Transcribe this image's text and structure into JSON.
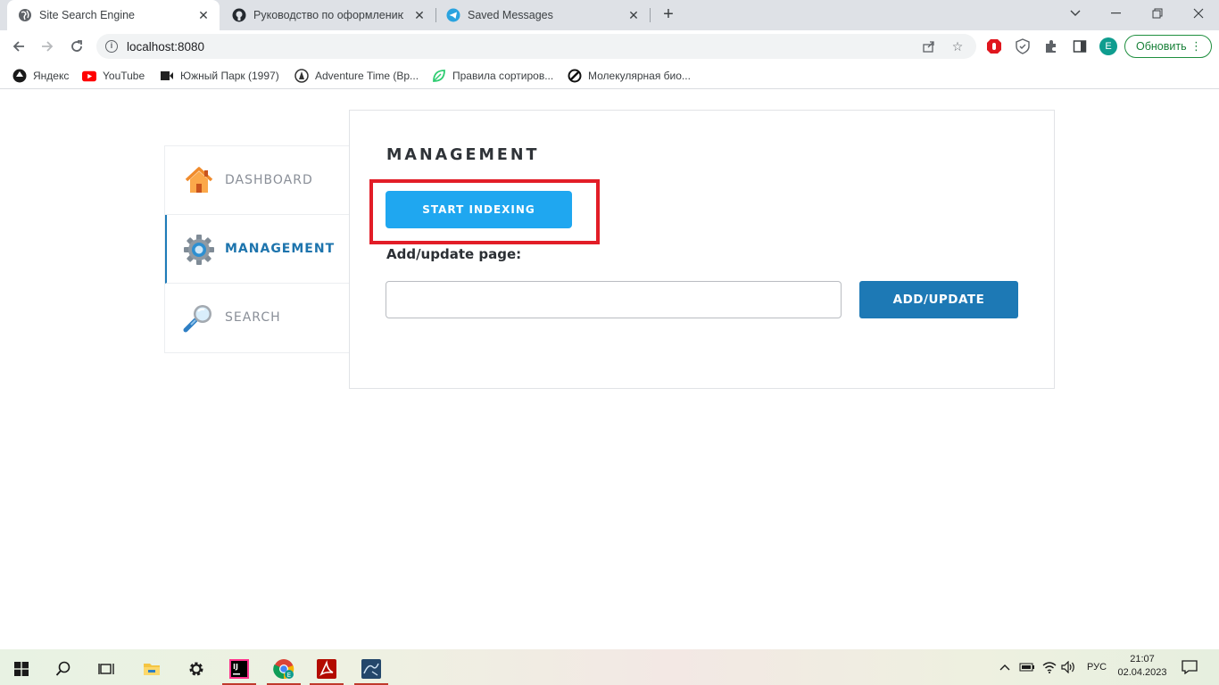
{
  "browser": {
    "tabs": [
      {
        "title": "Site Search Engine",
        "icon": "globe-icon",
        "active": true
      },
      {
        "title": "Руководство по оформлению M",
        "icon": "github-icon",
        "active": false
      },
      {
        "title": "Saved Messages",
        "icon": "telegram-icon",
        "active": false
      }
    ],
    "new_tab": "+",
    "url": "localhost:8080",
    "update_label": "Обновить",
    "profile_initial": "E"
  },
  "bookmarks": [
    {
      "label": "Яндекс",
      "icon": "yandex-icon"
    },
    {
      "label": "YouTube",
      "icon": "youtube-icon"
    },
    {
      "label": "Южный Парк (1997)",
      "icon": "video-icon"
    },
    {
      "label": "Adventure Time (Вр...",
      "icon": "adventure-time-icon"
    },
    {
      "label": "Правила сортиров...",
      "icon": "leaf-icon"
    },
    {
      "label": "Молекулярная био...",
      "icon": "link-icon"
    }
  ],
  "sidebar": {
    "items": [
      {
        "label": "DASHBOARD",
        "icon": "house-icon",
        "active": false
      },
      {
        "label": "MANAGEMENT",
        "icon": "gear-icon",
        "active": true
      },
      {
        "label": "SEARCH",
        "icon": "magnifier-icon",
        "active": false
      }
    ]
  },
  "main": {
    "heading": "MANAGEMENT",
    "start_button": "START INDEXING",
    "field_label": "Add/update page:",
    "page_input_value": "",
    "page_input_placeholder": "",
    "add_button": "ADD/UPDATE"
  },
  "taskbar": {
    "apps": [
      "windows-start-icon",
      "search-icon",
      "task-view-icon",
      "file-explorer-icon",
      "settings-icon",
      "intellij-icon",
      "chrome-icon",
      "acrobat-icon",
      "mysql-workbench-icon"
    ],
    "language": "РУС",
    "time": "21:07",
    "date": "02.04.2023"
  }
}
